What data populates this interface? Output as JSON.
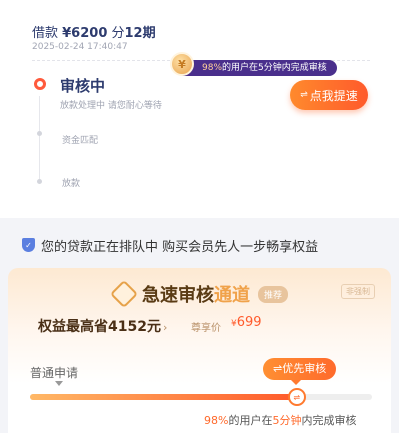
{
  "loan": {
    "prefix": "借款 ",
    "amount": "¥6200",
    "mid": " 分",
    "term": "12期",
    "time": "2025-02-24 17:40:47"
  },
  "tip": {
    "coin_symbol": "¥",
    "percent": "98%",
    "text_a": "的用户在",
    "minutes": "5分钟",
    "text_b": "内完成审核"
  },
  "status": {
    "title": "审核中",
    "subtitle": "放款处理中 请您耐心等待",
    "urge_button": "点我提速",
    "urge_icon": "⇌"
  },
  "steps": [
    {
      "label": "资金匹配"
    },
    {
      "label": "放款"
    }
  ],
  "queue": {
    "text": "您的贷款正在排队中 购买会员先人一步畅享权益",
    "shield_icon": "✓"
  },
  "promo": {
    "title_main": "急速审核",
    "title_accent": "通道",
    "tag": "推荐",
    "tag2": "非强制",
    "benefit": "权益最高省4152元",
    "benefit_arrow": "›",
    "price_label": "尊享价",
    "price_currency": "¥",
    "price_value": "699",
    "normal_label": "普通申请",
    "priority_label": "⇌优先审核",
    "progress": 0.78,
    "note_percent": "98%",
    "note_a": "的用户在",
    "note_minutes": "5分钟",
    "note_b": "内完成审核"
  },
  "colors": {
    "accent": "#ff6a2c",
    "navy": "#2d3b6e"
  }
}
